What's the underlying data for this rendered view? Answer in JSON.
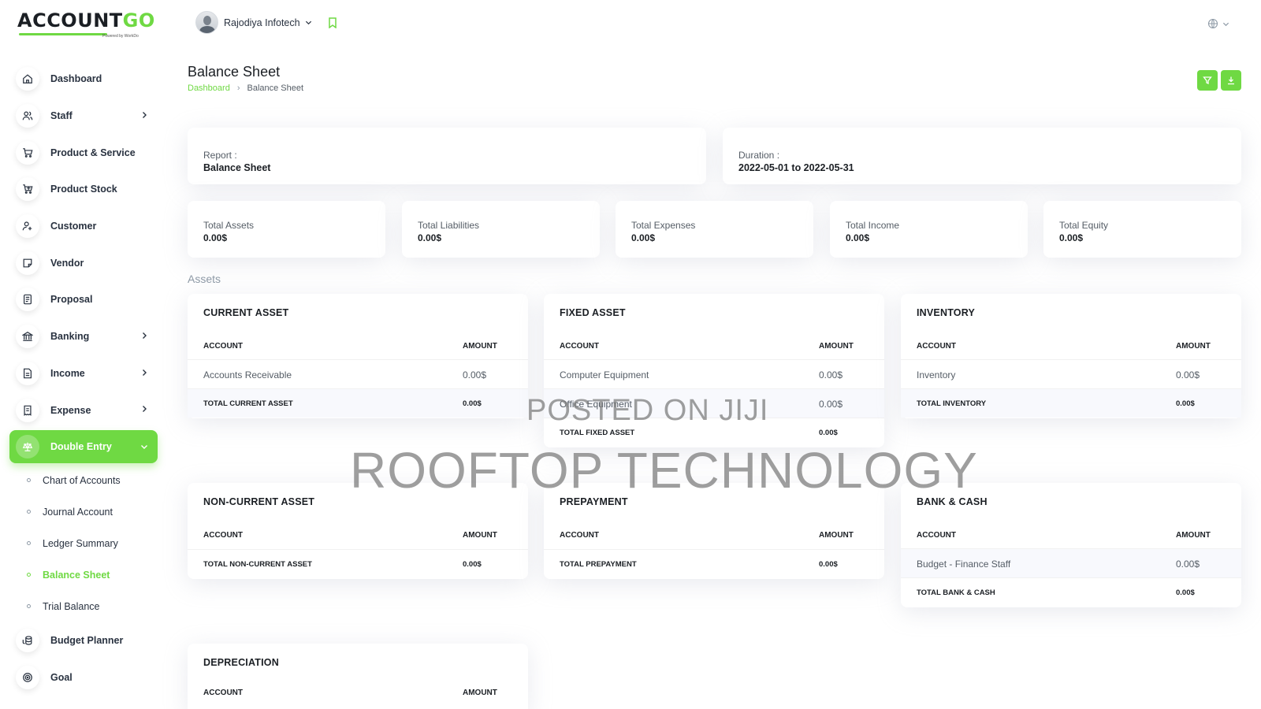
{
  "app": {
    "logo_main": "ACCOUNT",
    "logo_accent": "GO",
    "logo_sub": "Powered by WorkDo"
  },
  "sidebar": {
    "items": [
      {
        "label": "Dashboard",
        "icon": "home-icon"
      },
      {
        "label": "Staff",
        "icon": "users-icon",
        "has_chevron": true
      },
      {
        "label": "Product & Service",
        "icon": "cart-icon"
      },
      {
        "label": "Product Stock",
        "icon": "cart-icon"
      },
      {
        "label": "Customer",
        "icon": "user-plus-icon"
      },
      {
        "label": "Vendor",
        "icon": "note-icon"
      },
      {
        "label": "Proposal",
        "icon": "document-icon"
      },
      {
        "label": "Banking",
        "icon": "bank-icon",
        "has_chevron": true
      },
      {
        "label": "Income",
        "icon": "invoice-icon",
        "has_chevron": true
      },
      {
        "label": "Expense",
        "icon": "receipt-icon",
        "has_chevron": true
      },
      {
        "label": "Double Entry",
        "icon": "scale-icon",
        "active": true
      }
    ],
    "double_entry_sub": [
      {
        "label": "Chart of Accounts"
      },
      {
        "label": "Journal Account"
      },
      {
        "label": "Ledger Summary"
      },
      {
        "label": "Balance Sheet",
        "active": true
      },
      {
        "label": "Trial Balance"
      }
    ],
    "bottom_items": [
      {
        "label": "Budget Planner",
        "icon": "coins-icon"
      },
      {
        "label": "Goal",
        "icon": "target-icon"
      }
    ]
  },
  "header": {
    "user_name": "Rajodiya Infotech"
  },
  "page": {
    "title": "Balance Sheet",
    "breadcrumb": [
      "Dashboard",
      "Balance Sheet"
    ]
  },
  "info": {
    "report_label": "Report :",
    "report_value": "Balance Sheet",
    "duration_label": "Duration :",
    "duration_value": "2022-05-01 to 2022-05-31"
  },
  "stats": [
    {
      "label": "Total Assets",
      "value": "0.00$"
    },
    {
      "label": "Total Liabilities",
      "value": "0.00$"
    },
    {
      "label": "Total Expenses",
      "value": "0.00$"
    },
    {
      "label": "Total Income",
      "value": "0.00$"
    },
    {
      "label": "Total Equity",
      "value": "0.00$"
    }
  ],
  "assets_title": "Assets",
  "columns": {
    "account": "ACCOUNT",
    "amount": "AMOUNT"
  },
  "tables": {
    "current_asset": {
      "title": "CURRENT ASSET",
      "rows": [
        {
          "account": "Accounts Receivable",
          "amount": "0.00$"
        }
      ],
      "total": {
        "label": "TOTAL CURRENT ASSET",
        "amount": "0.00$"
      }
    },
    "fixed_asset": {
      "title": "FIXED ASSET",
      "rows": [
        {
          "account": "Computer Equipment",
          "amount": "0.00$"
        },
        {
          "account": "Office Equipment",
          "amount": "0.00$"
        }
      ],
      "total": {
        "label": "TOTAL FIXED ASSET",
        "amount": "0.00$"
      }
    },
    "inventory": {
      "title": "INVENTORY",
      "rows": [
        {
          "account": "Inventory",
          "amount": "0.00$"
        }
      ],
      "total": {
        "label": "TOTAL INVENTORY",
        "amount": "0.00$"
      }
    },
    "non_current_asset": {
      "title": "NON-CURRENT ASSET",
      "rows": [],
      "total": {
        "label": "TOTAL NON-CURRENT ASSET",
        "amount": "0.00$"
      }
    },
    "prepayment": {
      "title": "PREPAYMENT",
      "rows": [],
      "total": {
        "label": "TOTAL PREPAYMENT",
        "amount": "0.00$"
      }
    },
    "bank_cash": {
      "title": "BANK & CASH",
      "rows": [
        {
          "account": "Budget - Finance Staff",
          "amount": "0.00$"
        }
      ],
      "total": {
        "label": "TOTAL BANK & CASH",
        "amount": "0.00$"
      }
    },
    "depreciation": {
      "title": "DEPRECIATION",
      "rows": [],
      "total": null
    }
  },
  "watermark": {
    "line1": "POSTED ON JIJI",
    "line2": "ROOFTOP TECHNOLOGY"
  },
  "colors": {
    "accent": "#6fd943",
    "text": "#293240",
    "muted": "#8e9aa6"
  }
}
